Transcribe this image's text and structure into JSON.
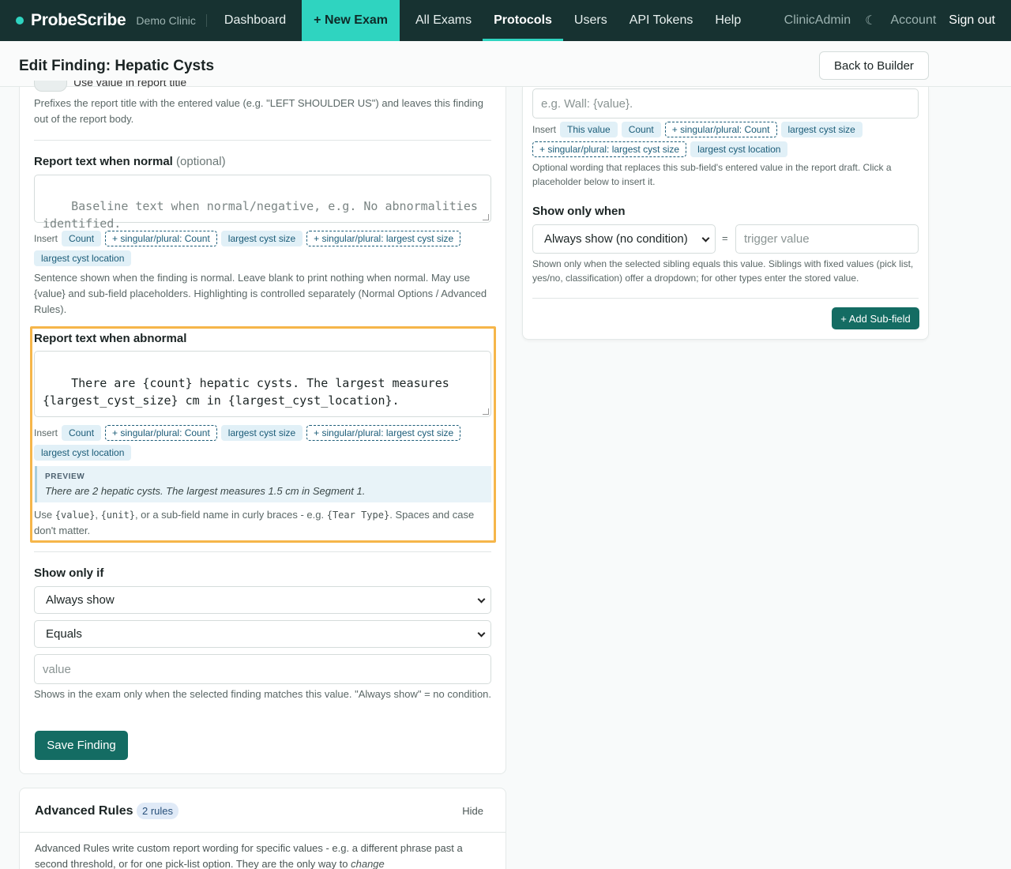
{
  "nav": {
    "brand": "ProbeScribe",
    "clinic": "Demo Clinic",
    "links": [
      "Dashboard",
      "+ New Exam",
      "All Exams",
      "Protocols",
      "Users",
      "API Tokens",
      "Help"
    ],
    "active": "Protocols",
    "user": "ClinicAdmin",
    "theme_icon": "☾",
    "account": "Account",
    "signout": "Sign out"
  },
  "header": {
    "title": "Edit Finding: Hepatic Cysts",
    "back": "Back to Builder"
  },
  "left": {
    "toggle_label": "Use value in report title",
    "toggle_help": "Prefixes the report title with the entered value (e.g. \"LEFT SHOULDER US\") and leaves this finding out of the report body.",
    "normal": {
      "label": "Report text when normal",
      "optional": "(optional)",
      "placeholder": "Baseline text when normal/negative, e.g. No abnormalities identified.",
      "insert_label": "Insert",
      "chips": [
        "Count",
        "+ singular/plural: Count",
        "largest cyst size",
        "+ singular/plural: largest cyst size",
        "largest cyst location"
      ],
      "help": "Sentence shown when the finding is normal. Leave blank to print nothing when normal. May use {value} and sub-field placeholders. Highlighting is controlled separately (Normal Options / Advanced Rules)."
    },
    "abnormal": {
      "label": "Report text when abnormal",
      "value": "There are {count} hepatic cysts. The largest measures {largest_cyst_size} cm in {largest_cyst_location}.",
      "insert_label": "Insert",
      "chips": [
        "Count",
        "+ singular/plural: Count",
        "largest cyst size",
        "+ singular/plural: largest cyst size",
        "largest cyst location"
      ],
      "preview_label": "PREVIEW",
      "preview_text": "There are 2 hepatic cysts. The largest measures 1.5 cm in Segment 1.",
      "help_prefix": "Use",
      "code_value": "{value}",
      "comma": ",",
      "code_unit": "{unit}",
      "help_mid": ", or a sub-field name in curly braces - e.g.",
      "code_tear": "{Tear Type}",
      "help_suffix": ". Spaces and case don't matter."
    },
    "show_only_if": {
      "label": "Show only if",
      "select1": "Always show",
      "select2": "Equals",
      "value_placeholder": "value",
      "help": "Shows in the exam only when the selected finding matches this value. \"Always show\" = no condition."
    },
    "save": "Save Finding"
  },
  "advanced": {
    "title": "Advanced Rules",
    "badge": "2 rules",
    "hide": "Hide",
    "body": "Advanced Rules write custom report wording for specific values - e.g. a different phrase past a second threshold, or for one pick-list option. They are the only way to",
    "body_em": "change"
  },
  "right": {
    "wording_placeholder": "e.g. Wall: {value}.",
    "insert_label": "Insert",
    "chips": [
      "This value",
      "Count",
      "+ singular/plural: Count",
      "largest cyst size",
      "+ singular/plural: largest cyst size",
      "largest cyst location"
    ],
    "wording_help": "Optional wording that replaces this sub-field's entered value in the report draft. Click a placeholder below to insert it.",
    "show_when_label": "Show only when",
    "condition_select": "Always show (no condition)",
    "equals": "=",
    "trigger_placeholder": "trigger value",
    "condition_help": "Shown only when the selected sibling equals this value. Siblings with fixed values (pick list, yes/no, classification) offer a dropdown; for other types enter the stored value.",
    "add_subfield": "+ Add Sub-field"
  }
}
